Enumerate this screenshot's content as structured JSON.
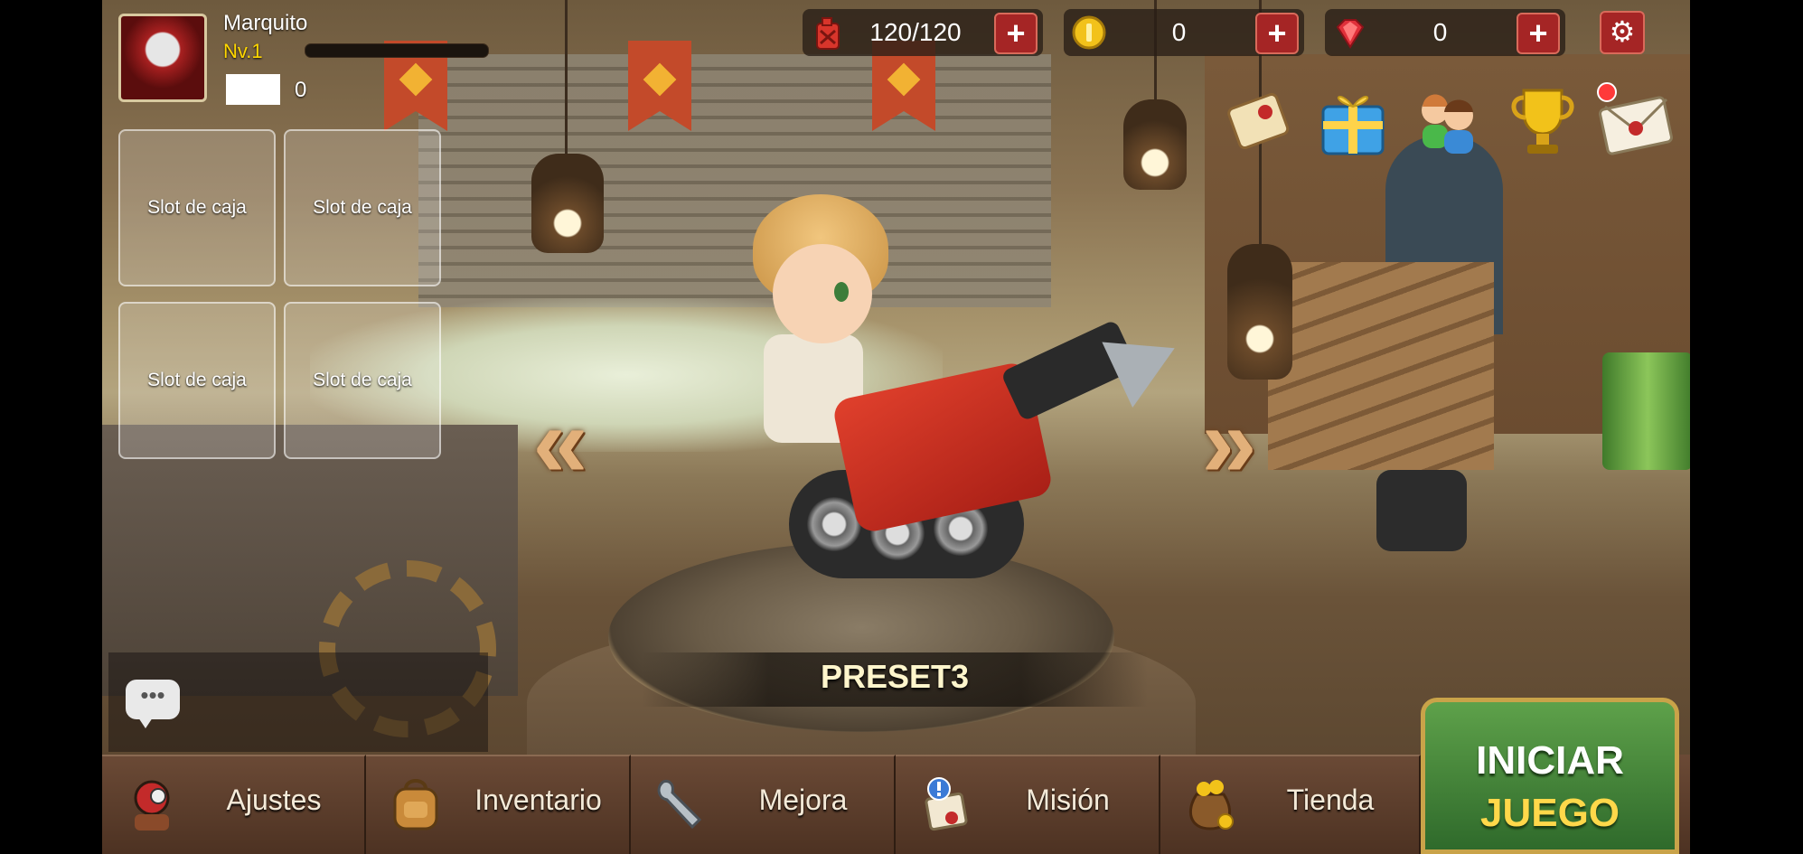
{
  "player": {
    "name": "Marquito",
    "level": "Nv.1",
    "xp_fraction": 0,
    "box_count": "0"
  },
  "slots": [
    {
      "label": "Slot de caja"
    },
    {
      "label": "Slot de caja"
    },
    {
      "label": "Slot de caja"
    },
    {
      "label": "Slot de caja"
    }
  ],
  "resources": {
    "fuel": {
      "value": "120/120",
      "icon": "fuel-can-icon",
      "color": "#d8352b"
    },
    "gold": {
      "value": "0",
      "icon": "gold-coin-icon",
      "color": "#f2c21a"
    },
    "gems": {
      "value": "0",
      "icon": "ruby-gem-icon",
      "color": "#e0303a"
    }
  },
  "top_icons": [
    {
      "name": "scroll-icon"
    },
    {
      "name": "gift-box-icon"
    },
    {
      "name": "friends-icon"
    },
    {
      "name": "trophy-icon"
    },
    {
      "name": "mail-icon"
    }
  ],
  "preset": {
    "label": "PRESET3"
  },
  "nav": [
    {
      "label": "Ajustes",
      "icon": "robot-settings-icon"
    },
    {
      "label": "Inventario",
      "icon": "backpack-icon"
    },
    {
      "label": "Mejora",
      "icon": "wrench-icon"
    },
    {
      "label": "Misión",
      "icon": "mission-scroll-icon"
    },
    {
      "label": "Tienda",
      "icon": "treasure-bag-icon"
    }
  ],
  "start_button": {
    "line1": "INICIAR",
    "line2": "JUEGO"
  },
  "colors": {
    "accent_red": "#a52525",
    "start_green": "#4a8a3a",
    "level_yellow": "#ffd700"
  }
}
